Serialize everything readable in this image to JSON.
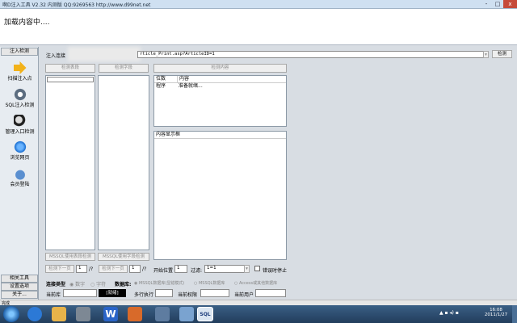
{
  "window": {
    "title": "啊D注入工具 V2.32 内测版 QQ:9269563 http://www.d99net.net",
    "controls": [
      "-",
      "□",
      "x"
    ]
  },
  "loading_text": "加载内容中....",
  "sidebar": {
    "top_tab": "注入检测",
    "items": [
      {
        "label": "扫描注入点",
        "icon": "arrow-right-icon"
      },
      {
        "label": "SQL注入检测",
        "icon": "gear-icon"
      },
      {
        "label": "管理入口检测",
        "icon": "magnifier-icon"
      },
      {
        "label": "浏览网页",
        "icon": "ie-browser-icon"
      },
      {
        "label": "会员登陆",
        "icon": "apple-icon"
      }
    ],
    "bottom_tabs": [
      "相关工具",
      "设置选项",
      "关于..."
    ]
  },
  "url_bar": {
    "label": "注入连接",
    "value": "rticle_Print.asp?ArticleID=1",
    "button": "检测"
  },
  "detect_buttons": {
    "tables": "检测表段",
    "fields": "检测字段",
    "content": "检测内容"
  },
  "result_table": {
    "headers": [
      "位数",
      "内容"
    ],
    "rows": [
      [
        "程序",
        "准备就绪..."
      ]
    ]
  },
  "content_display_header": "内容显示框",
  "lower_buttons": {
    "mssql_tables": "MSSQL使用表段检测",
    "mssql_fields": "MSSQL使用字段检测",
    "next_page_1": "检测下一页",
    "page_1": "1",
    "sep_1": "/?",
    "next_page_2": "检测下一页",
    "page_2": "1",
    "sep_2": "/?",
    "start_pos_label": "开始位置",
    "start_pos": "1",
    "filter_label": "过滤:",
    "filter_value": "1=1",
    "stop_on_error": "错误时停止"
  },
  "inject_type": {
    "label": "连接类型",
    "options": [
      "数字",
      "字符"
    ],
    "db_label": "数据库:",
    "db_options": [
      "MSSQL数据库(显错模式)",
      "MSSQL数据库",
      "Access或其他数据库"
    ]
  },
  "status_row": {
    "current_db": "当前库",
    "mode_value": "[就绪]",
    "multi_exec": "多行执行",
    "current_perm": "当前权限",
    "current_user": "当前用户"
  },
  "status_bar_text": "完成",
  "taskbar": {
    "time": "16:08",
    "date": "2011/1/27",
    "colors": {
      "bar": "#2d4d70",
      "accent": "#f0a020"
    }
  }
}
